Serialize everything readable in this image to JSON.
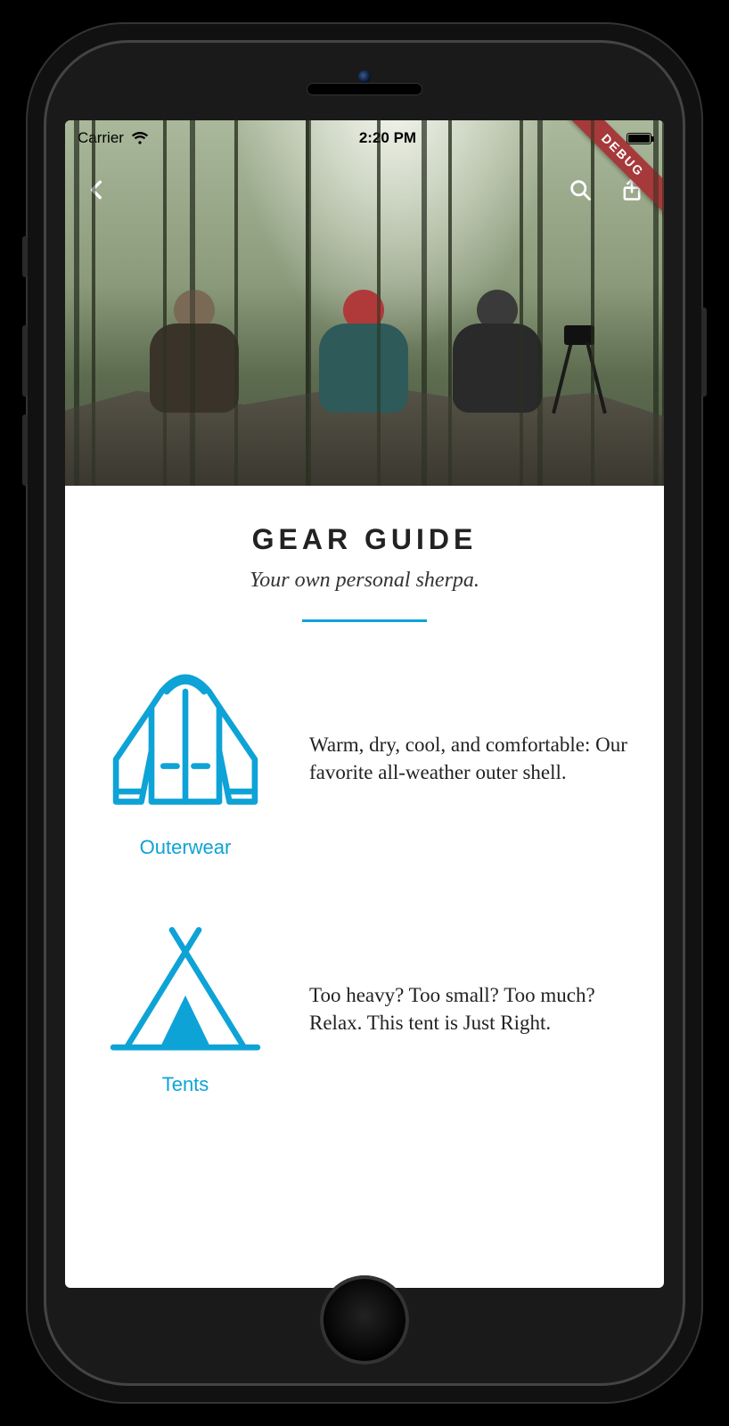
{
  "statusbar": {
    "carrier": "Carrier",
    "time": "2:20 PM"
  },
  "debug_label": "DEBUG",
  "header": {
    "title": "GEAR GUIDE",
    "subtitle": "Your own personal sherpa."
  },
  "accent_color": "#0ea3d6",
  "items": [
    {
      "icon": "jacket-icon",
      "label": "Outerwear",
      "description": "Warm, dry, cool, and comfortable: Our favorite all-weather outer shell."
    },
    {
      "icon": "tent-icon",
      "label": "Tents",
      "description": "Too heavy? Too small? Too much? Relax. This tent is Just Right."
    }
  ]
}
